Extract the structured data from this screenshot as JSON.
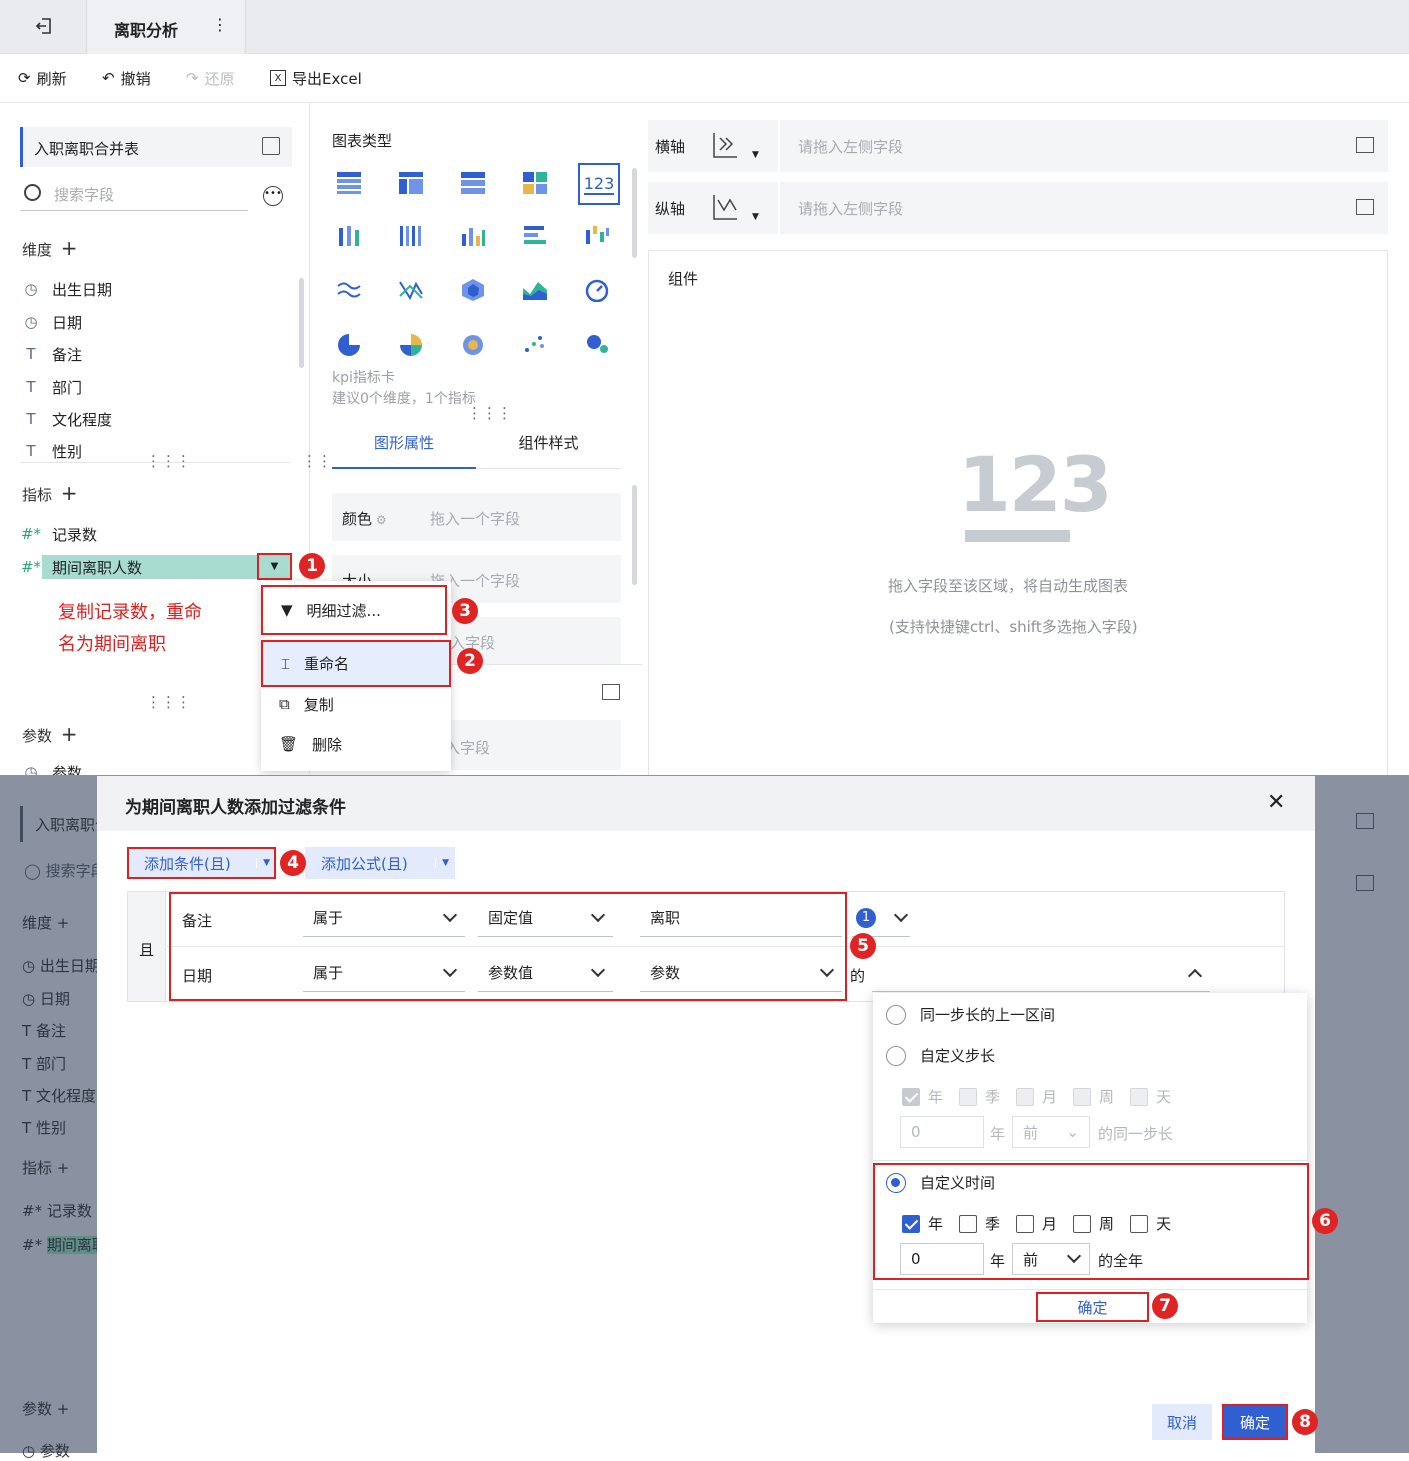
{
  "header": {
    "title": "离职分析",
    "more": "⋮"
  },
  "toolbar": {
    "refresh": "刷新",
    "undo": "撤销",
    "redo": "还原",
    "export": "导出Excel"
  },
  "left": {
    "table_name": "入职离职合并表",
    "search_placeholder": "搜索字段",
    "dimension_label": "维度",
    "dimensions": [
      "出生日期",
      "日期",
      "备注",
      "部门",
      "文化程度",
      "性别"
    ],
    "measure_label": "指标",
    "measures": [
      "记录数",
      "期间离职人数"
    ],
    "param_label": "参数",
    "param_item": "参数",
    "annotation": "复制记录数，重命名为期间离职"
  },
  "context_menu": {
    "items": [
      "明细过滤...",
      "重命名",
      "复制",
      "删除"
    ]
  },
  "chart_types": {
    "title": "图表类型",
    "desc_name": "kpi指标卡",
    "desc_hint": "建议0个维度，1个指标",
    "kpi_icon": "123"
  },
  "props": {
    "tab1": "图形属性",
    "tab2": "组件样式",
    "color": "颜色",
    "size": "大小",
    "drop_hint": "拖入一个字段",
    "drop_hint_short": "入字段",
    "drop_hint2": "拖入字段"
  },
  "axes": {
    "x": "横轴",
    "y": "纵轴",
    "placeholder": "请拖入左侧字段"
  },
  "component": {
    "title": "组件",
    "big": "123",
    "hint1": "拖入字段至该区域，将自动生成图表",
    "hint2": "(支持快捷键ctrl、shift多选拖入字段)"
  },
  "dialog": {
    "title": "为期间离职人数添加过滤条件",
    "add_condition": "添加条件(且)",
    "add_formula": "添加公式(且)",
    "and": "且",
    "row1": {
      "field": "备注",
      "op": "属于",
      "type": "固定值",
      "value": "离职",
      "count": "1"
    },
    "row2": {
      "field": "日期",
      "op": "属于",
      "type": "参数值",
      "value": "参数",
      "suffix": "的"
    },
    "cancel": "取消",
    "ok": "确定"
  },
  "popup": {
    "opt1": "同一步长的上一区间",
    "opt2": "自定义步长",
    "opt3": "自定义时间",
    "units": [
      "年",
      "季",
      "月",
      "周",
      "天"
    ],
    "value": "0",
    "unit": "年",
    "dir": "前",
    "suffix_step": "的同一步长",
    "suffix_time": "的全年",
    "confirm": "确定"
  },
  "badges": [
    "1",
    "2",
    "3",
    "4",
    "5",
    "6",
    "7",
    "8"
  ]
}
